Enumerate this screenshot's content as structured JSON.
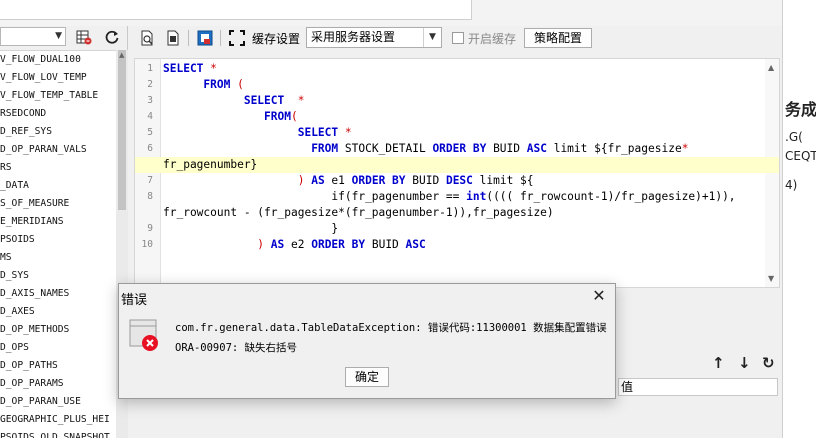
{
  "left_panel": {
    "tables": [
      "V_FLOW_DUAL100",
      "V_FLOW_LOV_TEMP",
      "V_FLOW_TEMP_TABLE",
      "RSEDCOND",
      "D_REF_SYS",
      "D_OP_PARAN_VALS",
      "RS",
      "_DATA",
      "S_OF_MEASURE",
      "E_MERIDIANS",
      "PSOIDS",
      "MS",
      "D_SYS",
      "D_AXIS_NAMES",
      "D_AXES",
      "D_OP_METHODS",
      "D_OPS",
      "D_OP_PATHS",
      "D_OP_PARAMS",
      "D_OP_PARAN_USE",
      "GEOGRAPHIC_PLUS_HEI",
      "PSOIDS_OLD_SNAPSHOT"
    ]
  },
  "toolbar": {
    "cache_label": "缓存设置",
    "cache_option": "采用服务器设置",
    "enable_cache_label": "开启缓存",
    "strategy_button": "策略配置"
  },
  "sql_lines": [
    {
      "n": "1",
      "segs": [
        [
          "kw",
          "SELECT "
        ],
        [
          "op",
          "*"
        ]
      ]
    },
    {
      "n": "2",
      "segs": [
        [
          "t",
          "      "
        ],
        [
          "kw",
          "FROM "
        ],
        [
          "op",
          "("
        ]
      ]
    },
    {
      "n": "3",
      "segs": [
        [
          "t",
          "            "
        ],
        [
          "kw",
          "SELECT  "
        ],
        [
          "op",
          "*"
        ]
      ]
    },
    {
      "n": "4",
      "segs": [
        [
          "t",
          "               "
        ],
        [
          "kw",
          "FROM"
        ],
        [
          "op",
          "("
        ]
      ]
    },
    {
      "n": "5",
      "segs": [
        [
          "t",
          "                    "
        ],
        [
          "kw",
          "SELECT "
        ],
        [
          "op",
          "*"
        ]
      ]
    },
    {
      "n": "6",
      "segs": [
        [
          "t",
          "                      "
        ],
        [
          "kw",
          "FROM "
        ],
        [
          "t",
          "STOCK_DETAIL "
        ],
        [
          "kw",
          "ORDER BY "
        ],
        [
          "t",
          "BUID "
        ],
        [
          "kw",
          "ASC "
        ],
        [
          "t",
          "limit ${fr_pagesize"
        ],
        [
          "op",
          "*"
        ]
      ]
    },
    {
      "n": "",
      "hl": true,
      "segs": [
        [
          "t",
          "fr_pagenumber}"
        ]
      ]
    },
    {
      "n": "7",
      "segs": [
        [
          "t",
          "                    "
        ],
        [
          "op",
          ") "
        ],
        [
          "kw",
          "AS "
        ],
        [
          "t",
          "e1 "
        ],
        [
          "kw",
          "ORDER BY "
        ],
        [
          "t",
          "BUID "
        ],
        [
          "kw",
          "DESC "
        ],
        [
          "t",
          "limit ${"
        ]
      ]
    },
    {
      "n": "8",
      "segs": [
        [
          "t",
          "                         if(fr_pagenumber == "
        ],
        [
          "kw",
          "int"
        ],
        [
          "t",
          "(((( fr_rowcount-1)/fr_pagesize)+1)),"
        ]
      ]
    },
    {
      "n": "",
      "segs": [
        [
          "t",
          "fr_rowcount - (fr_pagesize*(fr_pagenumber-1)),fr_pagesize)"
        ]
      ]
    },
    {
      "n": "9",
      "segs": [
        [
          "t",
          "                         }"
        ]
      ]
    },
    {
      "n": "10",
      "segs": [
        [
          "t",
          "              "
        ],
        [
          "op",
          ") "
        ],
        [
          "kw",
          "AS "
        ],
        [
          "t",
          "e2 "
        ],
        [
          "kw",
          "ORDER BY "
        ],
        [
          "t",
          "BUID "
        ],
        [
          "kw",
          "ASC"
        ]
      ]
    }
  ],
  "result": {
    "cell": "值"
  },
  "far_right": {
    "lines": [
      "务成",
      ".G(",
      "CEQT",
      "4)"
    ]
  },
  "dialog": {
    "title": "错误",
    "message_line1": "com.fr.general.data.TableDataException: 错误代码:11300001 数据集配置错误",
    "message_line2": "ORA-00907: 缺失右括号",
    "ok_button": "确定"
  },
  "colors": {
    "keyword": "#0000cc",
    "operator": "#cc0000",
    "highlight_line": "#ffffcc",
    "error_red": "#e81123"
  }
}
